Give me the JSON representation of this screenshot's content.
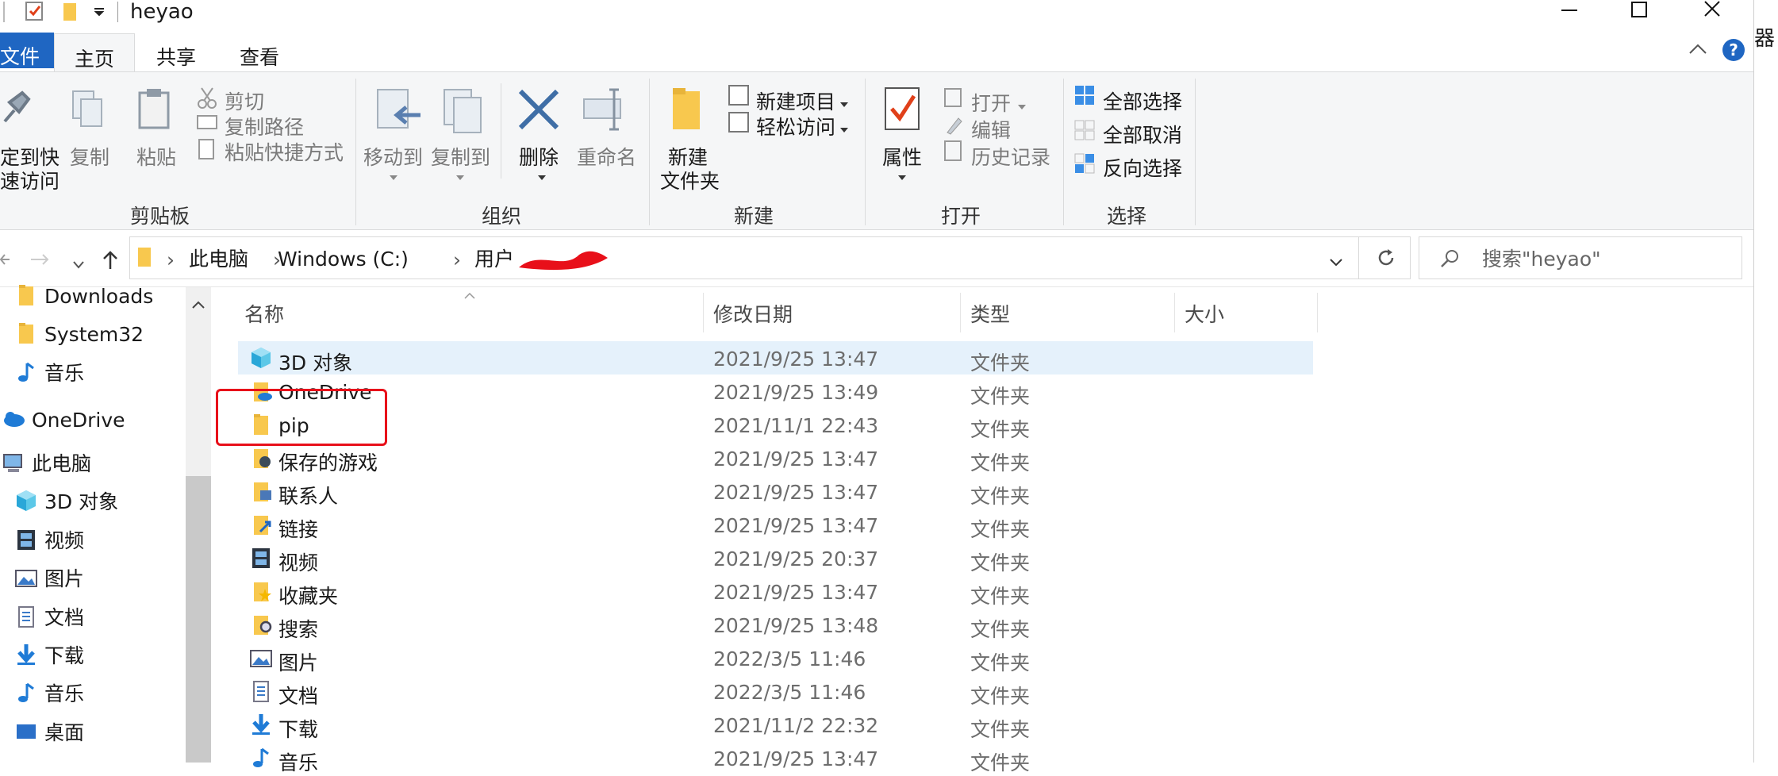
{
  "window": {
    "title": "heyao",
    "buttons": {
      "minimize": "—",
      "maximize": "☐",
      "close": "✕"
    }
  },
  "right_edge_text": "器",
  "tabs": [
    {
      "label": "文件"
    },
    {
      "label": "主页"
    },
    {
      "label": "共享"
    },
    {
      "label": "查看"
    }
  ],
  "ribbon": {
    "clipboard": {
      "pin": "定到快",
      "pin2": "速访问",
      "copy": "复制",
      "paste": "粘贴",
      "cut": "剪切",
      "copy_path": "复制路径",
      "paste_shortcut": "粘贴快捷方式",
      "group": "剪贴板"
    },
    "organize": {
      "move_to": "移动到",
      "copy_to": "复制到",
      "delete": "删除",
      "rename": "重命名",
      "group": "组织"
    },
    "new": {
      "new_folder": "新建",
      "new_folder2": "文件夹",
      "new_item": "新建项目",
      "easy_access": "轻松访问",
      "group": "新建"
    },
    "open": {
      "properties": "属性",
      "open": "打开",
      "edit": "编辑",
      "history": "历史记录",
      "group": "打开"
    },
    "select": {
      "select_all": "全部选择",
      "select_none": "全部取消",
      "invert": "反向选择",
      "group": "选择"
    }
  },
  "address": {
    "crumbs": [
      "此电脑",
      "Windows (C:)",
      "用户"
    ],
    "search_placeholder": "搜索\"heyao\""
  },
  "nav": [
    {
      "label": "Downloads",
      "icon": "folder-icon"
    },
    {
      "label": "System32",
      "icon": "folder-icon"
    },
    {
      "label": "音乐",
      "icon": "music-icon"
    },
    {
      "label": "OneDrive",
      "icon": "cloud-icon"
    },
    {
      "label": "此电脑",
      "icon": "computer-icon"
    },
    {
      "label": "3D 对象",
      "icon": "cube-icon"
    },
    {
      "label": "视频",
      "icon": "video-icon"
    },
    {
      "label": "图片",
      "icon": "picture-icon"
    },
    {
      "label": "文档",
      "icon": "document-icon"
    },
    {
      "label": "下载",
      "icon": "download-icon"
    },
    {
      "label": "音乐",
      "icon": "music-icon"
    },
    {
      "label": "桌面",
      "icon": "desktop-icon"
    }
  ],
  "columns": {
    "name": "名称",
    "modified": "修改日期",
    "type": "类型",
    "size": "大小"
  },
  "files": [
    {
      "name": "3D 对象",
      "date": "2021/9/25 13:47",
      "type": "文件夹",
      "icon": "cube-icon"
    },
    {
      "name": "OneDrive",
      "date": "2021/9/25 13:49",
      "type": "文件夹",
      "icon": "onedrive-folder-icon"
    },
    {
      "name": "pip",
      "date": "2021/11/1 22:43",
      "type": "文件夹",
      "icon": "folder-icon"
    },
    {
      "name": "保存的游戏",
      "date": "2021/9/25 13:47",
      "type": "文件夹",
      "icon": "saved-games-icon"
    },
    {
      "name": "联系人",
      "date": "2021/9/25 13:47",
      "type": "文件夹",
      "icon": "contacts-icon"
    },
    {
      "name": "链接",
      "date": "2021/9/25 13:47",
      "type": "文件夹",
      "icon": "links-icon"
    },
    {
      "name": "视频",
      "date": "2021/9/25 20:37",
      "type": "文件夹",
      "icon": "video-icon"
    },
    {
      "name": "收藏夹",
      "date": "2021/9/25 13:47",
      "type": "文件夹",
      "icon": "favorites-icon"
    },
    {
      "name": "搜索",
      "date": "2021/9/25 13:48",
      "type": "文件夹",
      "icon": "search-folder-icon"
    },
    {
      "name": "图片",
      "date": "2022/3/5 11:46",
      "type": "文件夹",
      "icon": "picture-icon"
    },
    {
      "name": "文档",
      "date": "2022/3/5 11:46",
      "type": "文件夹",
      "icon": "document-icon"
    },
    {
      "name": "下载",
      "date": "2021/11/2 22:32",
      "type": "文件夹",
      "icon": "download-icon"
    },
    {
      "name": "音乐",
      "date": "2021/9/25 13:47",
      "type": "文件夹",
      "icon": "music-icon"
    }
  ],
  "colors": {
    "accent": "#1f66c2",
    "folder": "#f8c84e",
    "selection": "#e5f1fb",
    "annotation": "#e8101a"
  }
}
